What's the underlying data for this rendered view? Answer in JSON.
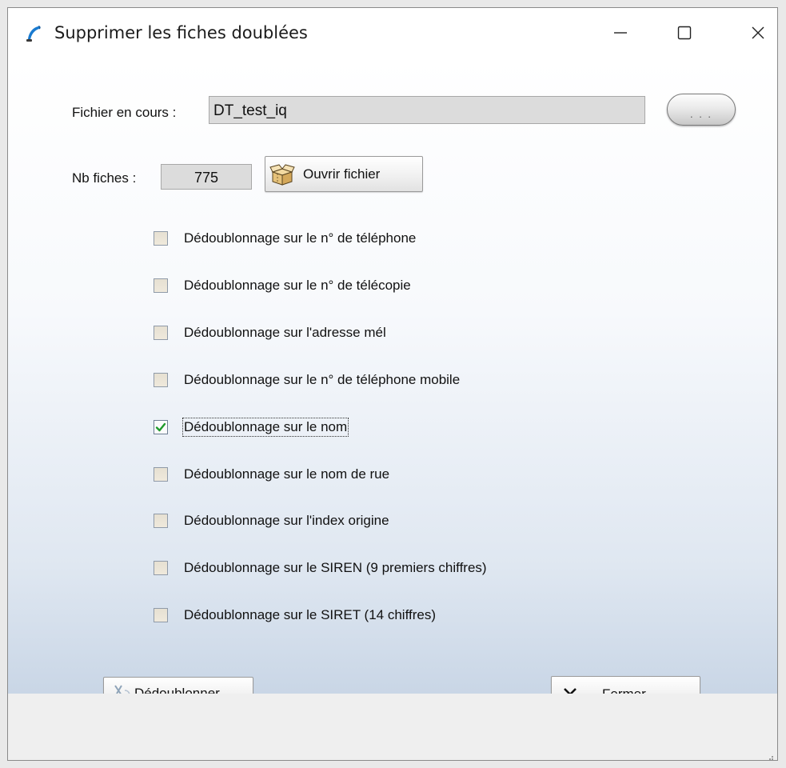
{
  "window": {
    "title": "Supprimer les fiches doublées"
  },
  "file": {
    "label": "Fichier en cours :",
    "value": "DT_test_iq",
    "browse_label": ". . ."
  },
  "count": {
    "label": "Nb fiches :",
    "value": "775",
    "open_button_label": "Ouvrir fichier"
  },
  "options": [
    {
      "label": "Dédoublonnage sur le n° de téléphone",
      "checked": false
    },
    {
      "label": "Dédoublonnage sur le n° de télécopie",
      "checked": false
    },
    {
      "label": "Dédoublonnage sur l'adresse mél",
      "checked": false
    },
    {
      "label": "Dédoublonnage sur le n° de téléphone mobile",
      "checked": false
    },
    {
      "label": "Dédoublonnage sur le nom",
      "checked": true
    },
    {
      "label": "Dédoublonnage sur le nom de rue",
      "checked": false
    },
    {
      "label": "Dédoublonnage sur l'index origine",
      "checked": false
    },
    {
      "label": "Dédoublonnage sur le SIREN (9 premiers chiffres)",
      "checked": false
    },
    {
      "label": "Dédoublonnage sur le SIRET (14 chiffres)",
      "checked": false
    }
  ],
  "actions": {
    "dedup_label": "Dédoublonner",
    "close_label": "Fermer"
  },
  "colors": {
    "check": "#1f9a2b",
    "field_bg": "#dcdcdc"
  }
}
